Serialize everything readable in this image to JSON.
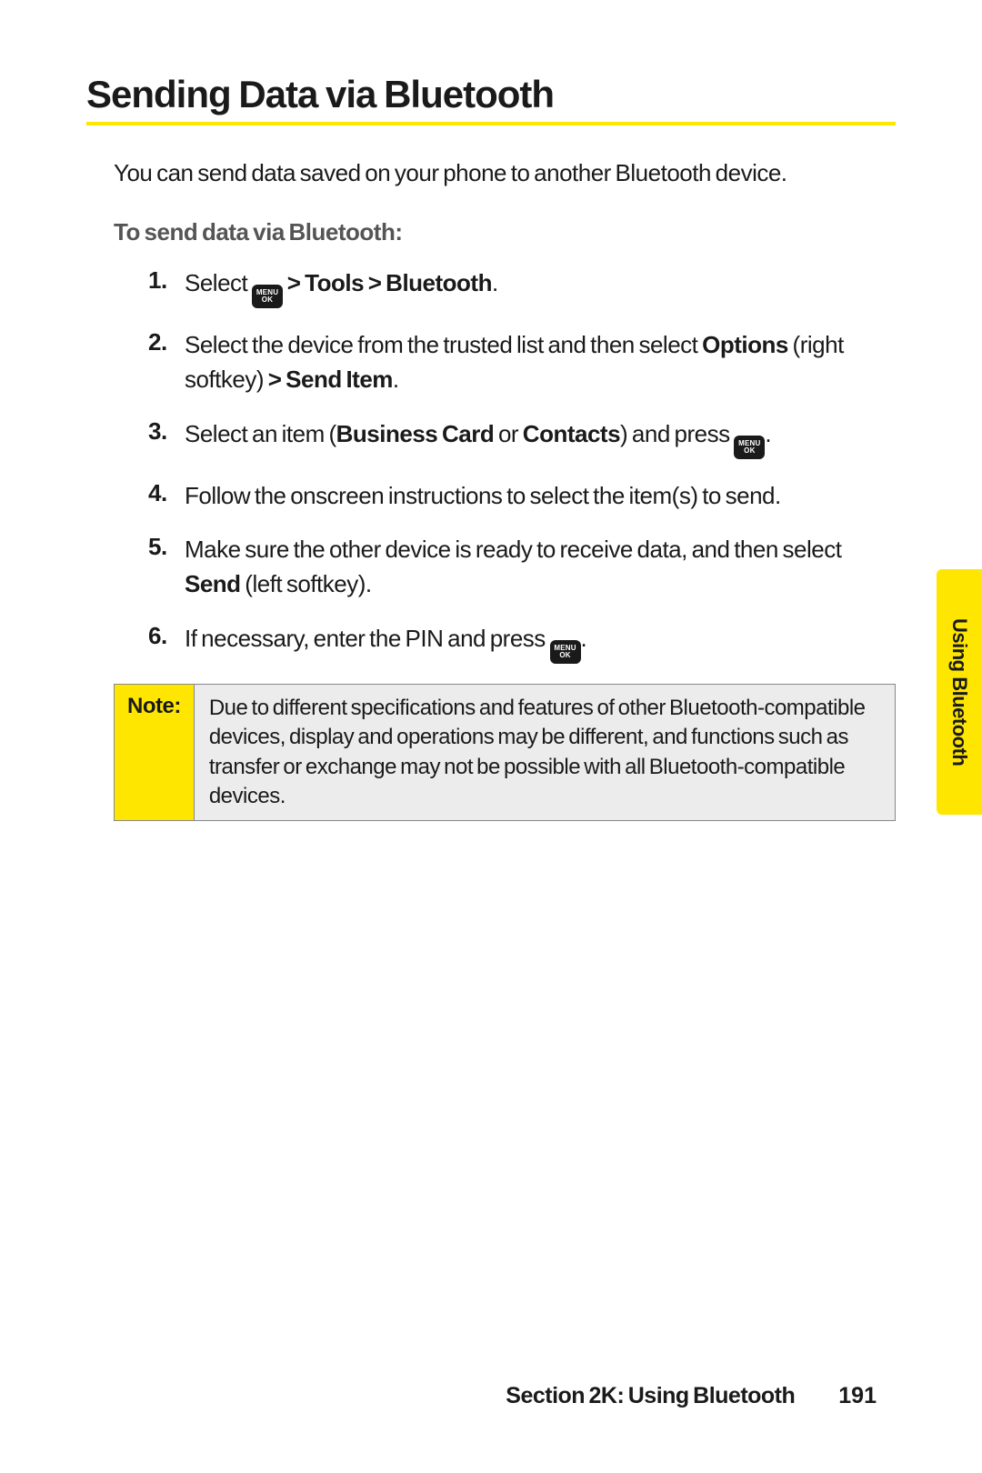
{
  "title": "Sending Data via Bluetooth",
  "intro": "You can send data saved on your phone to another Bluetooth device.",
  "subhead": "To send data via Bluetooth:",
  "menu_ok_top": "MENU",
  "menu_ok_bot": "OK",
  "steps": {
    "n1": "1.",
    "s1_a": "Select ",
    "s1_b": " > Tools > Bluetooth",
    "s1_c": ".",
    "n2": "2.",
    "s2_a": "Select the device from the trusted list and then select ",
    "s2_b": "Options",
    "s2_c": " (right softkey) ",
    "s2_d": "> Send Item",
    "s2_e": ".",
    "n3": "3.",
    "s3_a": "Select an item (",
    "s3_b": "Business Card",
    "s3_c": " or ",
    "s3_d": "Contacts",
    "s3_e": ") and press ",
    "s3_f": ".",
    "n4": "4.",
    "s4": "Follow the onscreen instructions to select the item(s) to send.",
    "n5": "5.",
    "s5_a": "Make sure the other device is ready to receive data, and then select ",
    "s5_b": "Send",
    "s5_c": " (left softkey).",
    "n6": "6.",
    "s6_a": "If necessary, enter the PIN and press ",
    "s6_b": "."
  },
  "note": {
    "label": "Note:",
    "content": "Due to different specifications and features of other Bluetooth-compatible devices, display and operations may be different, and functions such as transfer or exchange may not be possible with all Bluetooth-compatible devices."
  },
  "side_tab": "Using Bluetooth",
  "footer_section": "Section 2K: Using Bluetooth",
  "footer_page": "191"
}
